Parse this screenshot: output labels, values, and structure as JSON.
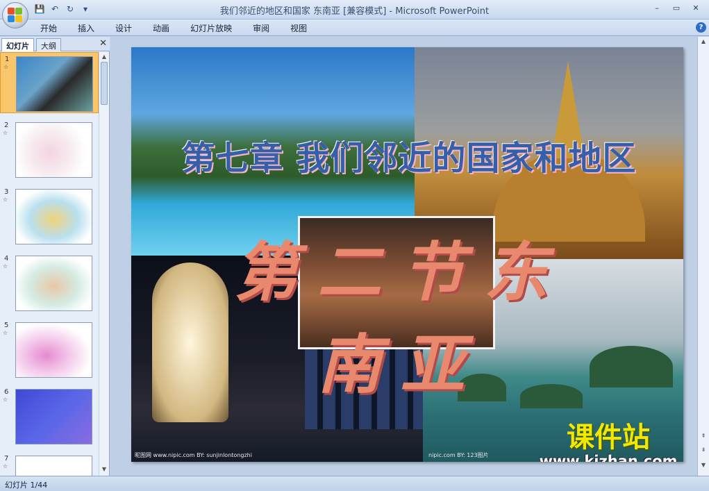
{
  "window": {
    "title": "我们邻近的地区和国家 东南亚 [兼容模式] - Microsoft PowerPoint",
    "controls": [
      "–",
      "▭",
      "✕"
    ]
  },
  "quick_access": {
    "icons": [
      "save-icon",
      "undo-icon",
      "redo-icon",
      "customize-icon"
    ],
    "save": "💾",
    "undo": "↶",
    "redo": "↻",
    "more": "▾"
  },
  "ribbon": {
    "tabs": [
      "开始",
      "插入",
      "设计",
      "动画",
      "幻灯片放映",
      "审阅",
      "视图"
    ],
    "help": "?"
  },
  "left_panel": {
    "tab_slides": "幻灯片",
    "tab_outline": "大纲",
    "close": "✕",
    "thumbnails": [
      {
        "number": "1",
        "anim": "☆",
        "selected": true
      },
      {
        "number": "2",
        "anim": "☆",
        "selected": false
      },
      {
        "number": "3",
        "anim": "☆",
        "selected": false
      },
      {
        "number": "4",
        "anim": "☆",
        "selected": false
      },
      {
        "number": "5",
        "anim": "☆",
        "selected": false
      },
      {
        "number": "6",
        "anim": "☆",
        "selected": false
      },
      {
        "number": "7",
        "anim": "☆",
        "selected": false
      }
    ]
  },
  "slide": {
    "title": "第七章  我们邻近的国家和地区",
    "subtitle": "第二节东南亚",
    "credit_left": "昵图网 www.nipic.com   BY: sunjinlontongzhi",
    "credit_right": "nipic.com BY: 123图片",
    "watermark_main": "课件站",
    "watermark_url": "www.kjzhan.com"
  },
  "status": {
    "slide_counter": "幻灯片 1/44"
  },
  "colors": {
    "title_blue": "#355fa8",
    "subtitle_orange": "#e8896e",
    "selected_thumb": "#f9c66b",
    "ribbon_bg": "#c9d9ef"
  }
}
